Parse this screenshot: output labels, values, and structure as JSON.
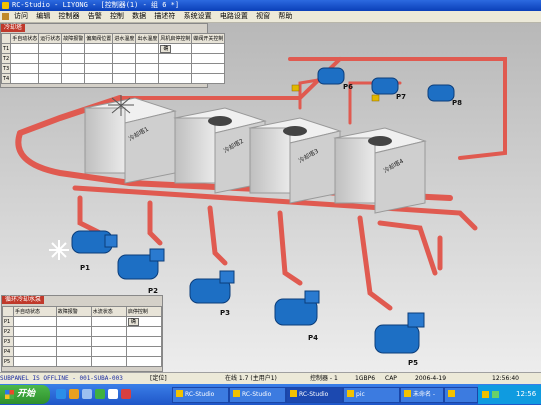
{
  "window": {
    "title": "RC-Studio - LIYONG - [控制器(1) - 组 6 *]"
  },
  "menu": [
    "访问",
    "编辑",
    "控制器",
    "告警",
    "控制",
    "数据",
    "描述符",
    "系统设置",
    "电路设置",
    "视窗",
    "帮助"
  ],
  "tower_panel": {
    "title": "冷却塔",
    "columns": [
      "手自动状态",
      "运行状态",
      "故障报警",
      "偏离阀位置",
      "进水温度",
      "出水温度",
      "风机启停控制",
      "蝶阀开关控制"
    ],
    "rows": [
      "T1",
      "T2",
      "T3",
      "T4"
    ],
    "button": "确"
  },
  "pump_panel": {
    "title": "循环冷却水泵",
    "columns": [
      "手自动状态",
      "故障报警",
      "水流状态",
      "启停控制"
    ],
    "rows": [
      "P1",
      "P2",
      "P3",
      "P4",
      "P5"
    ],
    "button": "确"
  },
  "scene_labels": {
    "towers": [
      "冷却塔1",
      "冷却塔2",
      "冷却塔3",
      "冷却塔4"
    ],
    "pumps": [
      "P1",
      "P2",
      "P3",
      "P4",
      "P5",
      "P6",
      "P7",
      "P8"
    ]
  },
  "colors": {
    "pipe": "#e05a50",
    "pump": "#1d6fc4",
    "tower": "#d8d8d8"
  },
  "status": {
    "offline": "SUBPANEL IS OFFLINE - 001-SUBA-003",
    "location": "[定位]",
    "online": "在线 1.7 (主用户1)",
    "controller": "控制器 - 1",
    "code": "1GBP6",
    "caps": "CAP",
    "date": "2006-4-19",
    "time": "12:56:40"
  },
  "taskbar": {
    "start": "开始",
    "items": [
      "RC-Studio",
      "RC-Studio",
      "RC-Studio",
      "pic",
      "未命名 -",
      ""
    ],
    "clock": "12:56"
  }
}
